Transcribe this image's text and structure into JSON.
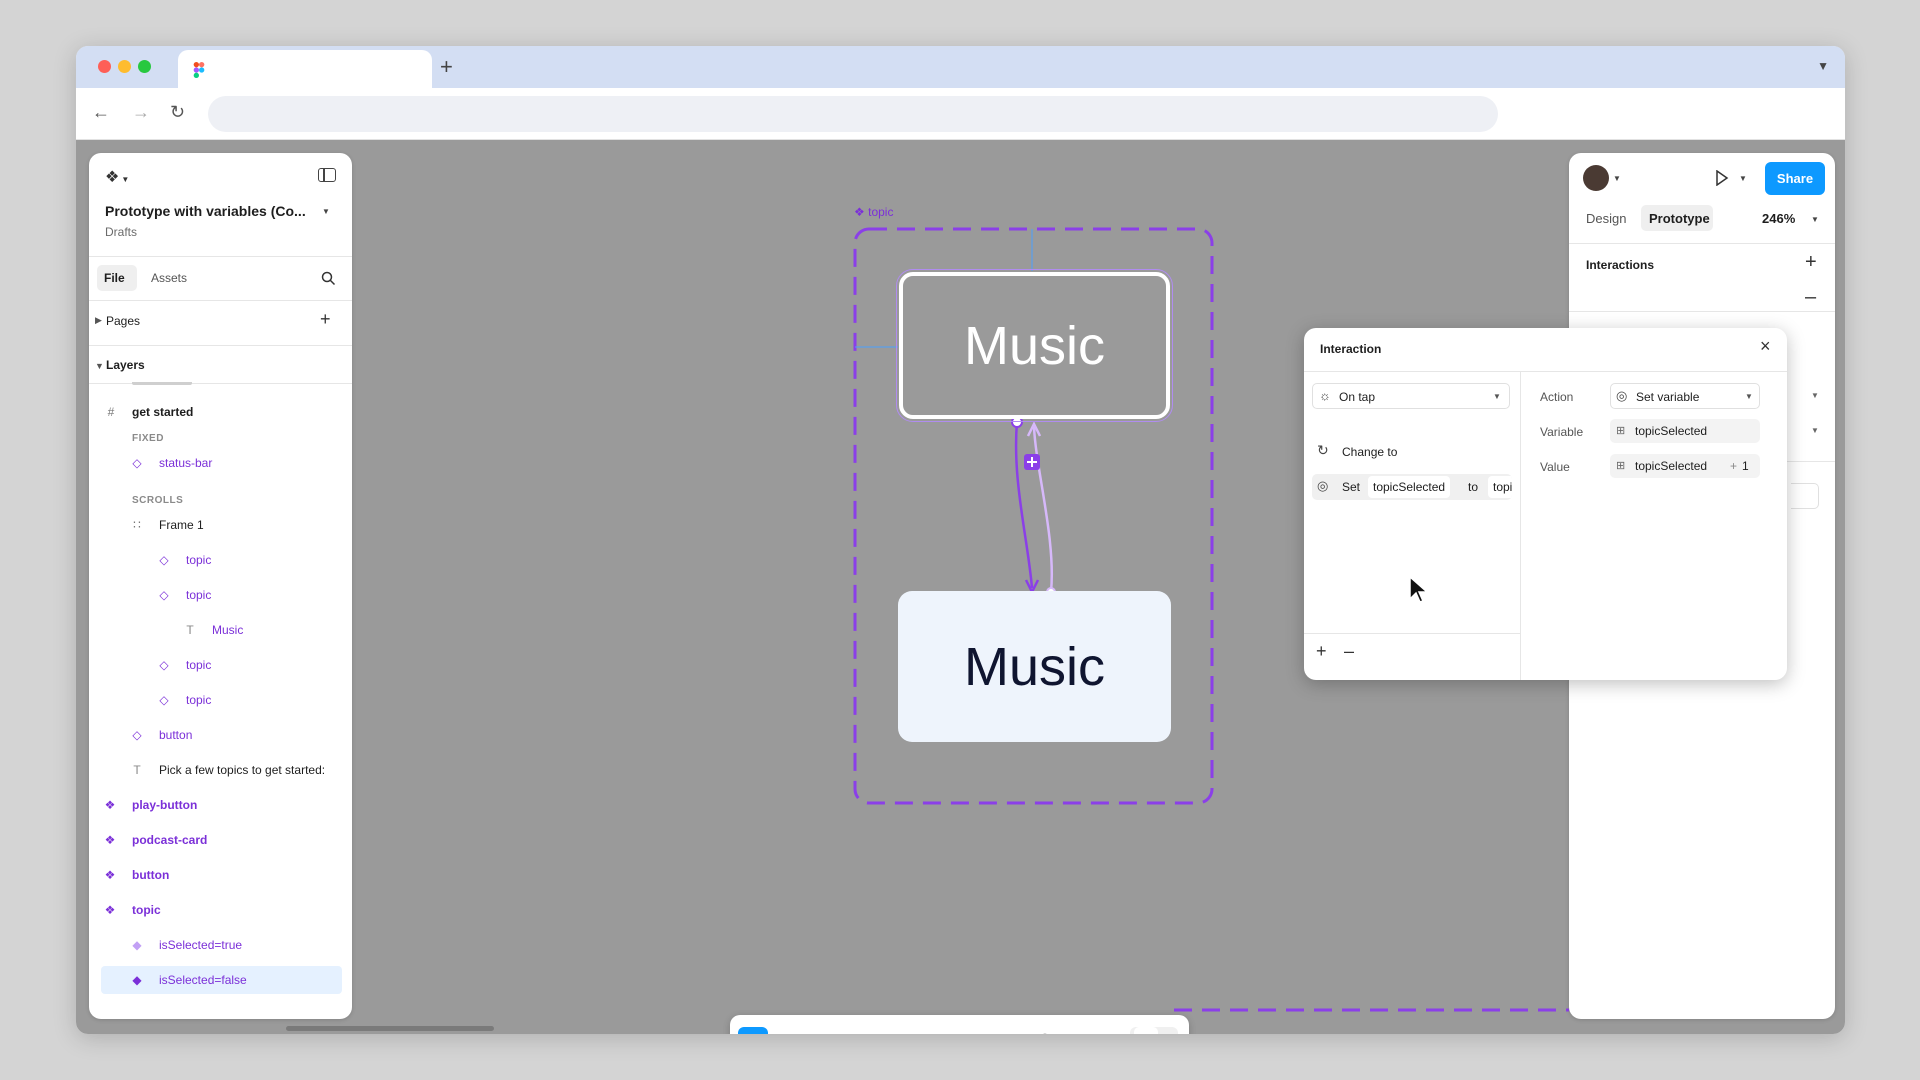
{
  "file": {
    "title": "Prototype with variables (Co...",
    "location": "Drafts"
  },
  "left_panel": {
    "tabs": [
      "File",
      "Assets"
    ],
    "pages_label": "Pages",
    "layers_label": "Layers",
    "layers": [
      {
        "name": "get started"
      },
      {
        "name": "FIXED"
      },
      {
        "name": "status-bar"
      },
      {
        "name": "SCROLLS"
      },
      {
        "name": "Frame 1"
      },
      {
        "name": "topic"
      },
      {
        "name": "topic"
      },
      {
        "name": "Music"
      },
      {
        "name": "topic"
      },
      {
        "name": "topic"
      },
      {
        "name": "button"
      },
      {
        "name": "Pick a few topics to get started:"
      },
      {
        "name": "play-button"
      },
      {
        "name": "podcast-card"
      },
      {
        "name": "button"
      },
      {
        "name": "topic"
      },
      {
        "name": "isSelected=true"
      },
      {
        "name": "isSelected=false"
      }
    ]
  },
  "canvas": {
    "frame_label": "topic",
    "card_selected_text": "Music",
    "card_default_text": "Music"
  },
  "right_panel": {
    "share_label": "Share",
    "tabs": [
      "Design",
      "Prototype"
    ],
    "zoom": "246%",
    "interactions_label": "Interactions"
  },
  "interaction": {
    "title": "Interaction",
    "trigger": "On tap",
    "actions": [
      {
        "label": "Change to"
      },
      {
        "verb": "Set",
        "variable": "topicSelected",
        "to_word": "to",
        "value": "topi"
      }
    ],
    "action_label": "Action",
    "action_value": "Set variable",
    "variable_label": "Variable",
    "variable_value": "topicSelected",
    "value_label": "Value",
    "value_variable": "topicSelected",
    "value_operator": "+",
    "value_operand": "1"
  },
  "colors": {
    "accent": "#0d99ff",
    "component": "#7b30d8",
    "selected_card": "#9a9a9a",
    "default_card": "#eef4fc"
  }
}
